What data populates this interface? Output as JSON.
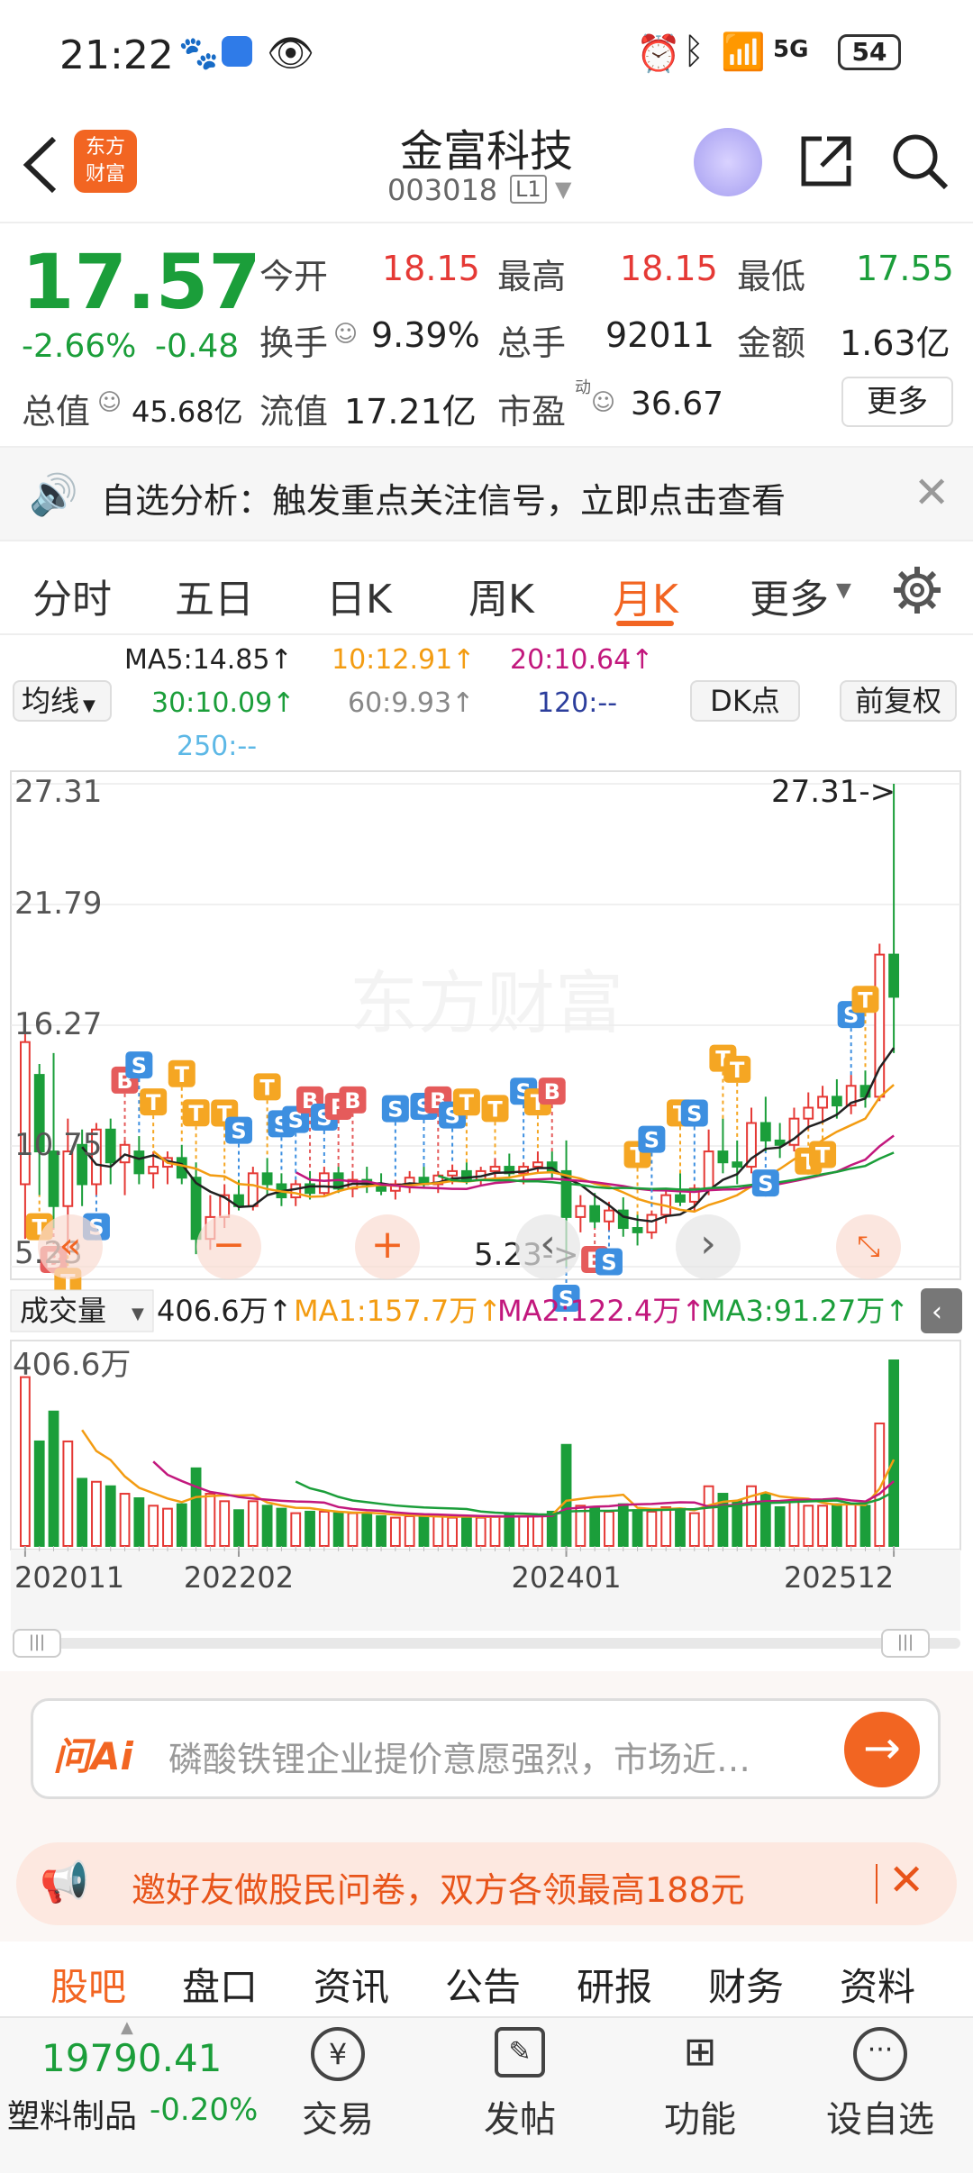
{
  "status_bar": {
    "time": "21:22",
    "battery": "54",
    "network": "5G"
  },
  "header": {
    "title": "金富科技",
    "code": "003018",
    "level": "L1"
  },
  "quote": {
    "price": "17.57",
    "change_pct": "-2.66%",
    "change": "-0.48",
    "open_label": "今开",
    "open": "18.15",
    "high_label": "最高",
    "high": "18.15",
    "low_label": "最低",
    "low": "17.55",
    "turnover_label": "换手",
    "turnover": "9.39%",
    "volume_label": "总手",
    "volume": "92011",
    "amount_label": "金额",
    "amount": "1.63亿",
    "mcap_label": "总值",
    "mcap": "45.68亿",
    "float_label": "流值",
    "float": "17.21亿",
    "pe_label": "市盈",
    "pe_sup": "动",
    "pe": "36.67",
    "more": "更多"
  },
  "notice": {
    "text": "自选分析：触发重点关注信号，立即点击查看"
  },
  "tabs": [
    "分时",
    "五日",
    "日K",
    "周K",
    "月K",
    "更多"
  ],
  "active_tab": "月K",
  "ma": {
    "ma5": "MA5:14.85↑",
    "ma10": "10:12.91↑",
    "ma20": "20:10.64↑",
    "ma30": "30:10.09↑",
    "ma60": "60:9.93↑",
    "ma120": "120:--",
    "ma250": "250:--",
    "selector": "均线",
    "dk": "DK点",
    "fq": "前复权"
  },
  "colors": {
    "up": "#e53935",
    "down": "#1b9e3a",
    "ma5": "#222222",
    "ma10": "#f39c12",
    "ma20": "#c2187d",
    "ma30": "#1b9e3a",
    "ma60": "#888888",
    "ma120": "#2c3e9c",
    "ma250": "#5db8e6",
    "accent": "#f26522"
  },
  "chart_data": {
    "type": "candlestick",
    "y_ticks": [
      "27.31",
      "21.79",
      "16.27",
      "10.75",
      "5.23"
    ],
    "max_label": "27.31->",
    "min_label": "5.23->",
    "watermark": "东方财富",
    "x_labels": [
      "202011",
      "202202",
      "202401",
      "202512"
    ],
    "candles": [
      {
        "o": 9.0,
        "h": 16.8,
        "l": 6.5,
        "c": 15.5
      },
      {
        "o": 14.0,
        "h": 14.5,
        "l": 8.5,
        "c": 10.5
      },
      {
        "o": 10.5,
        "h": 15.0,
        "l": 7.0,
        "c": 8.0
      },
      {
        "o": 8.0,
        "h": 12.0,
        "l": 6.0,
        "c": 10.5
      },
      {
        "o": 10.8,
        "h": 11.5,
        "l": 8.0,
        "c": 9.0
      },
      {
        "o": 9.0,
        "h": 11.8,
        "l": 8.5,
        "c": 11.5
      },
      {
        "o": 11.5,
        "h": 12.0,
        "l": 9.0,
        "c": 10.0
      },
      {
        "o": 10.0,
        "h": 11.0,
        "l": 8.5,
        "c": 10.8
      },
      {
        "o": 10.5,
        "h": 11.2,
        "l": 9.0,
        "c": 9.5
      },
      {
        "o": 9.5,
        "h": 10.5,
        "l": 8.8,
        "c": 9.8
      },
      {
        "o": 9.8,
        "h": 10.5,
        "l": 9.0,
        "c": 10.2
      },
      {
        "o": 10.2,
        "h": 10.8,
        "l": 9.0,
        "c": 9.3
      },
      {
        "o": 9.3,
        "h": 10.0,
        "l": 5.8,
        "c": 6.5
      },
      {
        "o": 6.5,
        "h": 8.5,
        "l": 6.0,
        "c": 7.5
      },
      {
        "o": 7.5,
        "h": 9.0,
        "l": 7.0,
        "c": 8.5
      },
      {
        "o": 8.5,
        "h": 9.2,
        "l": 7.8,
        "c": 8.0
      },
      {
        "o": 8.0,
        "h": 9.8,
        "l": 7.8,
        "c": 9.5
      },
      {
        "o": 9.5,
        "h": 10.2,
        "l": 8.5,
        "c": 9.0
      },
      {
        "o": 9.0,
        "h": 9.5,
        "l": 8.0,
        "c": 8.4
      },
      {
        "o": 8.4,
        "h": 9.2,
        "l": 8.0,
        "c": 9.0
      },
      {
        "o": 9.0,
        "h": 9.6,
        "l": 8.3,
        "c": 8.6
      },
      {
        "o": 8.6,
        "h": 9.8,
        "l": 8.5,
        "c": 9.5
      },
      {
        "o": 9.5,
        "h": 9.8,
        "l": 8.6,
        "c": 8.8
      },
      {
        "o": 8.8,
        "h": 9.6,
        "l": 8.4,
        "c": 9.2
      },
      {
        "o": 9.2,
        "h": 9.8,
        "l": 8.6,
        "c": 9.0
      },
      {
        "o": 9.0,
        "h": 9.5,
        "l": 8.5,
        "c": 8.7
      },
      {
        "o": 8.7,
        "h": 9.2,
        "l": 8.3,
        "c": 9.0
      },
      {
        "o": 9.0,
        "h": 9.6,
        "l": 8.6,
        "c": 9.3
      },
      {
        "o": 9.3,
        "h": 9.8,
        "l": 8.8,
        "c": 9.0
      },
      {
        "o": 9.0,
        "h": 9.6,
        "l": 8.6,
        "c": 9.4
      },
      {
        "o": 9.4,
        "h": 9.9,
        "l": 9.0,
        "c": 9.6
      },
      {
        "o": 9.6,
        "h": 10.0,
        "l": 9.0,
        "c": 9.2
      },
      {
        "o": 9.2,
        "h": 9.8,
        "l": 8.9,
        "c": 9.6
      },
      {
        "o": 9.6,
        "h": 10.2,
        "l": 9.2,
        "c": 9.8
      },
      {
        "o": 9.8,
        "h": 10.4,
        "l": 9.3,
        "c": 9.5
      },
      {
        "o": 9.5,
        "h": 10.0,
        "l": 9.0,
        "c": 9.8
      },
      {
        "o": 9.8,
        "h": 10.5,
        "l": 9.5,
        "c": 10.0
      },
      {
        "o": 10.0,
        "h": 10.5,
        "l": 9.2,
        "c": 9.6
      },
      {
        "o": 9.6,
        "h": 11.0,
        "l": 5.23,
        "c": 7.5
      },
      {
        "o": 7.5,
        "h": 8.5,
        "l": 6.8,
        "c": 8.0
      },
      {
        "o": 8.0,
        "h": 8.6,
        "l": 7.0,
        "c": 7.3
      },
      {
        "o": 7.3,
        "h": 8.2,
        "l": 6.9,
        "c": 7.8
      },
      {
        "o": 7.8,
        "h": 8.4,
        "l": 6.6,
        "c": 7.0
      },
      {
        "o": 7.0,
        "h": 7.6,
        "l": 6.2,
        "c": 6.8
      },
      {
        "o": 6.8,
        "h": 7.8,
        "l": 6.5,
        "c": 7.6
      },
      {
        "o": 7.6,
        "h": 8.8,
        "l": 7.2,
        "c": 8.5
      },
      {
        "o": 8.5,
        "h": 9.5,
        "l": 8.0,
        "c": 8.2
      },
      {
        "o": 8.2,
        "h": 9.0,
        "l": 7.8,
        "c": 8.8
      },
      {
        "o": 8.8,
        "h": 11.5,
        "l": 8.5,
        "c": 10.5
      },
      {
        "o": 10.5,
        "h": 12.0,
        "l": 9.5,
        "c": 10.0
      },
      {
        "o": 10.0,
        "h": 11.0,
        "l": 9.0,
        "c": 9.8
      },
      {
        "o": 9.8,
        "h": 12.5,
        "l": 9.5,
        "c": 11.8
      },
      {
        "o": 11.8,
        "h": 13.0,
        "l": 10.5,
        "c": 11.0
      },
      {
        "o": 11.0,
        "h": 11.8,
        "l": 10.2,
        "c": 10.8
      },
      {
        "o": 10.8,
        "h": 12.5,
        "l": 10.5,
        "c": 12.0
      },
      {
        "o": 12.0,
        "h": 13.2,
        "l": 11.5,
        "c": 12.5
      },
      {
        "o": 12.5,
        "h": 13.5,
        "l": 11.8,
        "c": 13.0
      },
      {
        "o": 13.0,
        "h": 13.8,
        "l": 12.0,
        "c": 12.6
      },
      {
        "o": 12.6,
        "h": 14.0,
        "l": 12.2,
        "c": 13.5
      },
      {
        "o": 13.5,
        "h": 14.2,
        "l": 12.5,
        "c": 13.0
      },
      {
        "o": 13.0,
        "h": 20.0,
        "l": 12.8,
        "c": 19.5
      },
      {
        "o": 19.5,
        "h": 27.31,
        "l": 15.0,
        "c": 17.57
      }
    ],
    "volume": {
      "label": "成交量",
      "value": "406.6万↑",
      "ma1": "MA1:157.7万↑",
      "ma2": "MA2:122.4万↑",
      "ma3": "MA3:91.27万↑",
      "max_label": "406.6万"
    }
  },
  "ai": {
    "brand": "问Ai",
    "text": "磷酸铁锂企业提价意愿强烈，市场近…"
  },
  "invite": {
    "text": "邀好友做股民问卷，双方各领最高188元"
  },
  "subtabs": [
    "股吧",
    "盘口",
    "资讯",
    "公告",
    "研报",
    "财务",
    "资料"
  ],
  "bottom": {
    "index_value": "19790.41",
    "index_name": "塑料制品",
    "index_change": "-0.20%",
    "buttons": [
      "交易",
      "发帖",
      "功能",
      "设自选"
    ]
  }
}
